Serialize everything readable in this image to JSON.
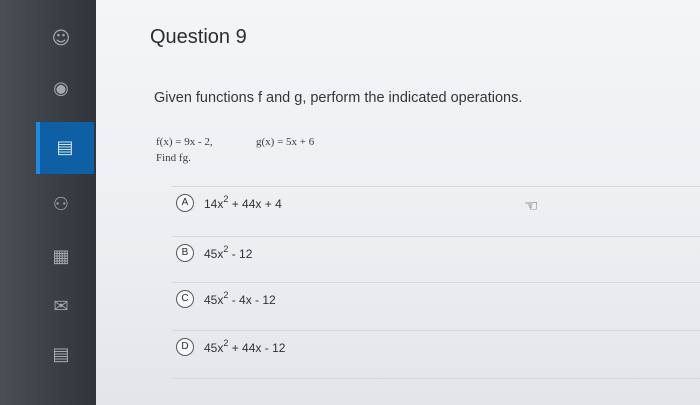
{
  "question": {
    "title": "Question 9",
    "prompt": "Given functions f and g, perform the indicated operations.",
    "f": "f(x) = 9x - 2,",
    "g": "g(x) = 5x + 6",
    "task": "Find fg."
  },
  "options": [
    {
      "letter": "A",
      "before": "14x",
      "exp": "2",
      "after": " + 44x + 4"
    },
    {
      "letter": "B",
      "before": "45x",
      "exp": "2",
      "after": " - 12"
    },
    {
      "letter": "C",
      "before": "45x",
      "exp": "2",
      "after": " - 4x - 12"
    },
    {
      "letter": "D",
      "before": "45x",
      "exp": "2",
      "after": " + 44x - 12"
    }
  ],
  "icons": {
    "sidebar": [
      "account-icon",
      "globe-icon",
      "courses-icon",
      "groups-icon",
      "calendar-icon",
      "inbox-icon",
      "history-icon"
    ],
    "cursor": "hand-pointer-icon"
  },
  "colors": {
    "sidebar_active": "#0e5fa3"
  }
}
